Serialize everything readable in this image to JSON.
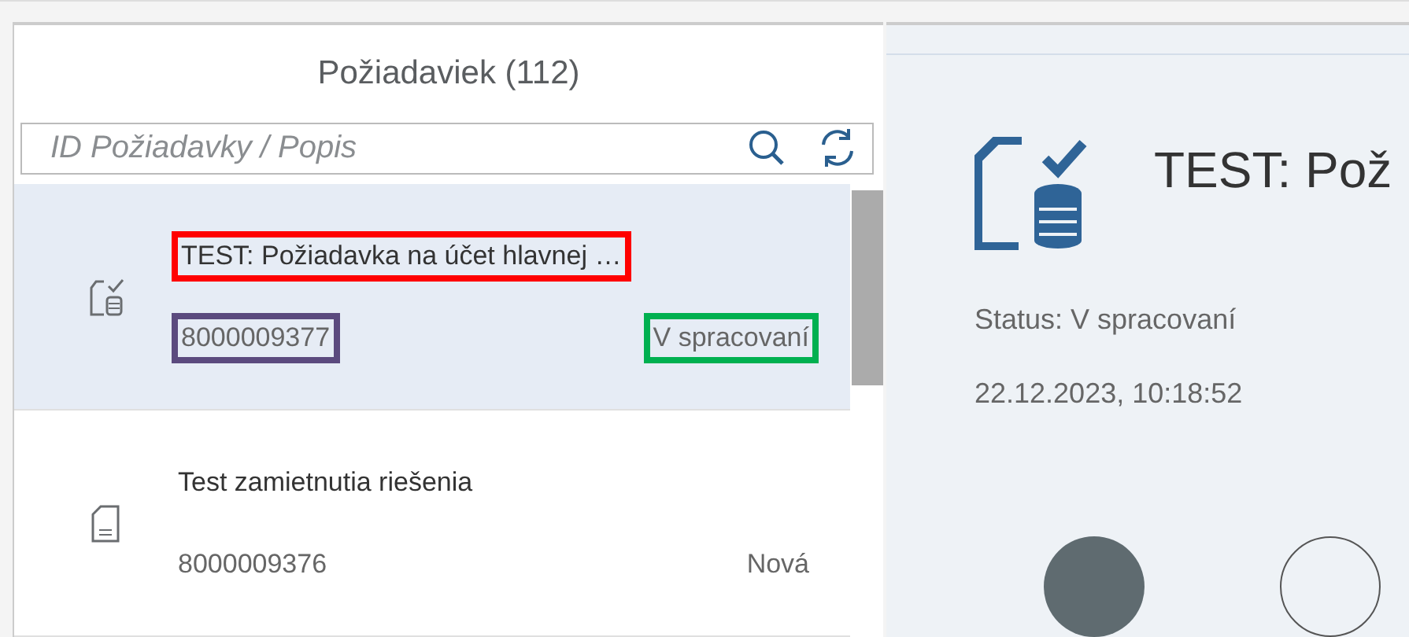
{
  "list": {
    "title": "Požiadaviek (112)",
    "search": {
      "placeholder": "ID Požiadavky / Popis"
    },
    "items": [
      {
        "kind": "checked",
        "title": "TEST: Požiadavka na účet hlavnej …",
        "id": "8000009377",
        "status": "V spracovaní",
        "selected": true,
        "title_frame": {
          "color": "#ff0000"
        },
        "id_frame": {
          "color": "#5b4a7e"
        },
        "status_frame": {
          "color": "#00b050"
        }
      },
      {
        "kind": "plain",
        "title": "Test zamietnutia riešenia",
        "id": "8000009376",
        "status": "Nová",
        "selected": false
      }
    ]
  },
  "detail": {
    "title": "TEST: Pož",
    "status": "Status: V spracovaní",
    "date": "22.12.2023, 10:18:52"
  }
}
